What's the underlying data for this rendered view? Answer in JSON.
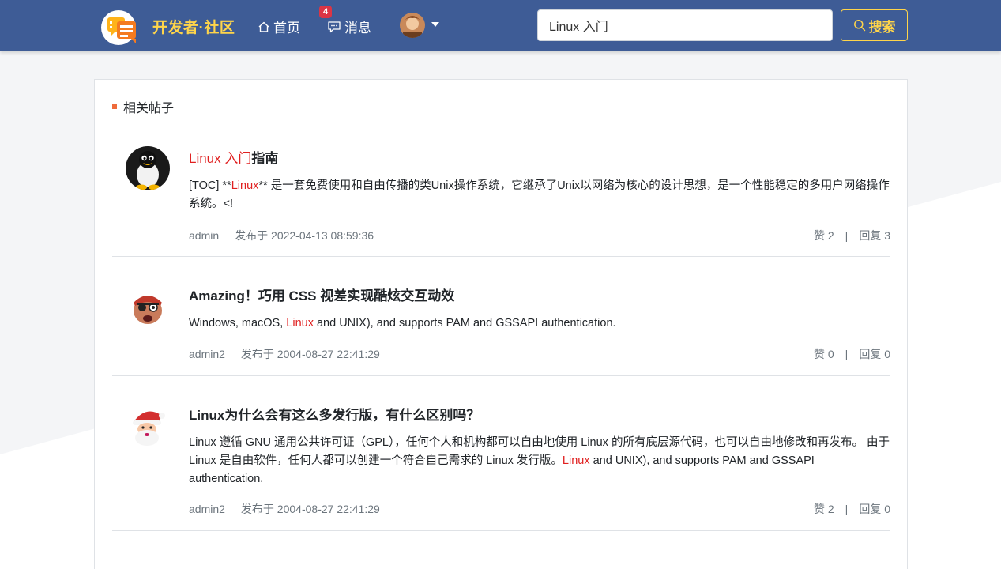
{
  "navbar": {
    "brand": "开发者·社区",
    "home_label": "首页",
    "messages_label": "消息",
    "messages_badge": "4",
    "search": {
      "value": "Linux 入门",
      "button_label": "搜索"
    },
    "colors": {
      "bar": "#3e5c96",
      "accent": "#ffd54a",
      "badge": "#dc3545"
    }
  },
  "section": {
    "title": "相关帖子"
  },
  "posts": [
    {
      "title_highlight": "Linux 入门",
      "title_rest": "指南",
      "summary_before": "[TOC] **",
      "summary_highlight": "Linux",
      "summary_after": "** 是一套免费使用和自由传播的类Unix操作系统，它继承了Unix以网络为核心的设计思想，是一个性能稳定的多用户网络操作系统。<!",
      "author": "admin",
      "published": "发布于 2022-04-13 08:59:36",
      "likes": "赞 2",
      "separator": "|",
      "replies": "回复 3",
      "avatar_icon": "penguin-avatar-icon"
    },
    {
      "title": "Amazing！巧用 CSS 视差实现酷炫交互动效",
      "summary_before": "Windows, macOS, ",
      "summary_highlight": "Linux",
      "summary_after": " and UNIX), and supports PAM and GSSAPI authentication.",
      "author": "admin2",
      "published": "发布于 2004-08-27 22:41:29",
      "likes": "赞 0",
      "separator": "|",
      "replies": "回复 0",
      "avatar_icon": "pirate-avatar-icon"
    },
    {
      "title": "Linux为什么会有这么多发行版，有什么区别吗？",
      "summary_before": "Linux 遵循 GNU 通用公共许可证（GPL），任何个人和机构都可以自由地使用 Linux 的所有底层源代码，也可以自由地修改和再发布。 由于 Linux 是自由软件，任何人都可以创建一个符合自己需求的 Linux 发行版。",
      "summary_highlight": "Linux",
      "summary_after": " and UNIX), and supports PAM and GSSAPI authentication.",
      "author": "admin2",
      "published": "发布于 2004-08-27 22:41:29",
      "likes": "赞 2",
      "separator": "|",
      "replies": "回复 0",
      "avatar_icon": "santa-avatar-icon"
    }
  ],
  "highlight_color": "#e02020"
}
